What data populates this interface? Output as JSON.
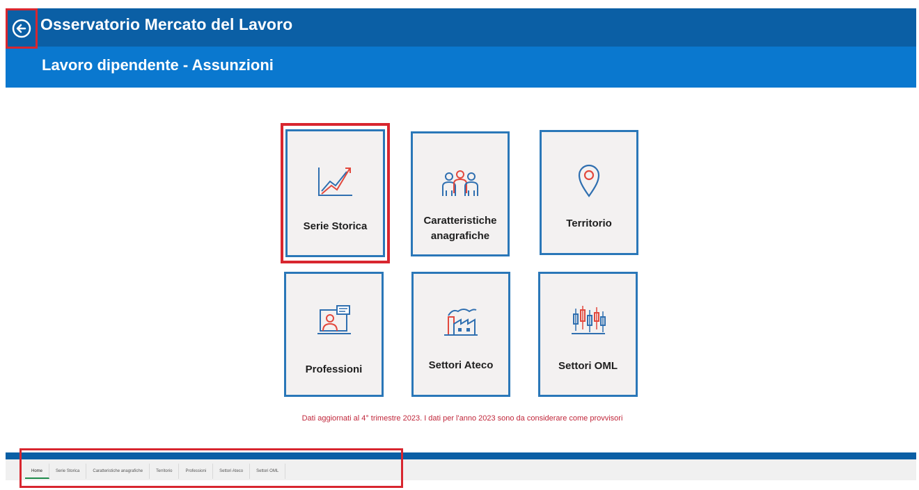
{
  "header": {
    "app_title": "Osservatorio Mercato del Lavoro",
    "subtitle": "Lavoro dipendente - Assunzioni",
    "back_icon": "back-arrow-circle-icon"
  },
  "tiles": [
    {
      "label": "Serie Storica",
      "icon": "trend-chart-icon",
      "selected": true
    },
    {
      "label_line1": "Caratteristiche",
      "label_line2": "anagrafiche",
      "icon": "people-group-icon"
    },
    {
      "label": "Territorio",
      "icon": "map-pin-icon"
    },
    {
      "label": "Professioni",
      "icon": "professional-presenter-icon"
    },
    {
      "label": "Settori Ateco",
      "icon": "factory-icon"
    },
    {
      "label": "Settori OML",
      "icon": "candlestick-chart-icon"
    }
  ],
  "footnote": "Dati aggiornati al 4° trimestre 2023. I dati per l'anno 2023 sono da considerare come provvisori",
  "tabs": [
    {
      "label": "Home",
      "active": true
    },
    {
      "label": "Serie Storica"
    },
    {
      "label": "Caratteristiche anagrafiche"
    },
    {
      "label": "Territorio"
    },
    {
      "label": "Professioni"
    },
    {
      "label": "Settori Ateco"
    },
    {
      "label": "Settori OML"
    }
  ],
  "colors": {
    "header_dark": "#0b5fa5",
    "header_light": "#0a78cf",
    "tile_border": "#2a77b8",
    "tile_bg": "#f3f1f1",
    "highlight_red": "#d8262f",
    "icon_blue": "#2f6fb0",
    "icon_red": "#e2483d",
    "footnote": "#c0263a"
  }
}
